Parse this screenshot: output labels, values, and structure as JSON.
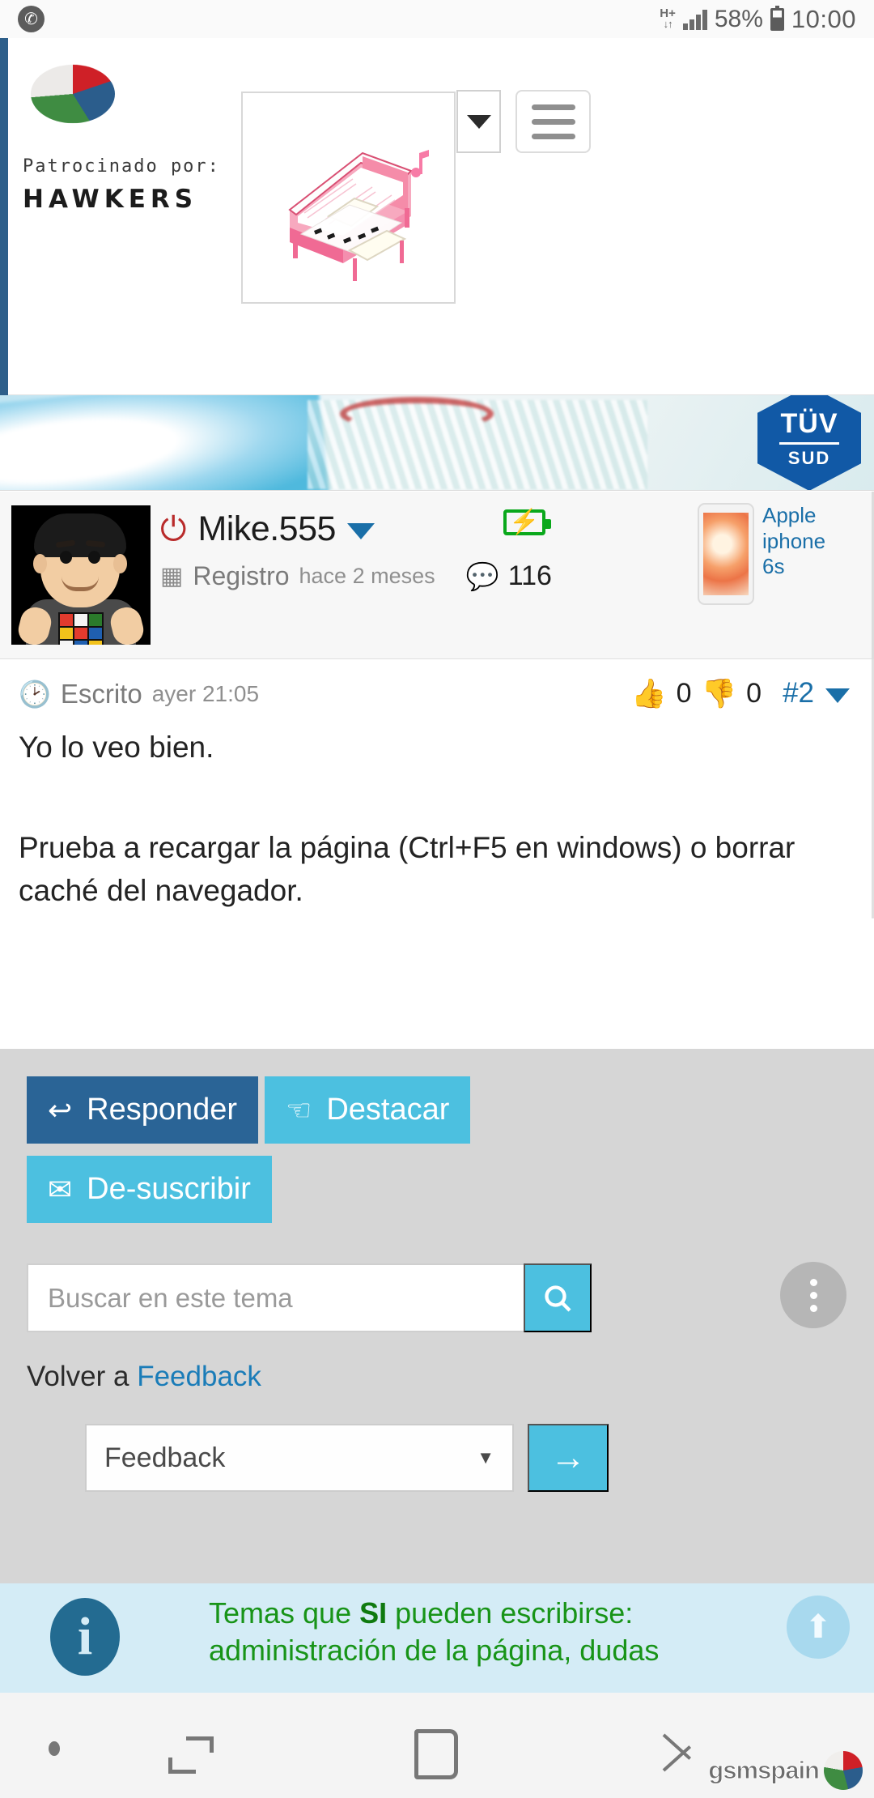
{
  "status_bar": {
    "phone_icon": "phone-icon",
    "network_type": "H+",
    "network_arrows": "↓↑",
    "battery_percent": "58%",
    "time": "10:00"
  },
  "sponsor": {
    "logo_icon": "gsmspain-pie-logo",
    "label": "Patrocinado por:",
    "brand": "HAWKERS",
    "ad_image_alt": "pink-pixel-piano",
    "caret_icon": "▼",
    "menu_icon": "hamburger-icon"
  },
  "banner_ad": {
    "badge_top": "TÜV",
    "badge_bottom": "SUD"
  },
  "post_header": {
    "avatar_alt": "cartoon-avatar-rubiks-cube",
    "status_icon": "power-icon",
    "username": "Mike.555",
    "user_caret": "▼",
    "charging_icon": "battery-charging-icon",
    "charging_bolt": "⚡",
    "register_icon": "calendar-icon",
    "register_label": "Registro",
    "register_value": "hace 2 meses",
    "comment_icon": "comment-bubble-icon",
    "comment_count": "116",
    "promo_image_alt": "apple-iphone-6s-thumbnail",
    "promo_text": "Apple iphone 6s"
  },
  "post": {
    "clock_icon": "clock-icon",
    "written_label": "Escrito",
    "written_time": "ayer 21:05",
    "thumb_up_icon": "👍",
    "thumb_up_count": "0",
    "thumb_down_icon": "👎",
    "thumb_down_count": "0",
    "post_number": "#2",
    "post_number_caret": "▼",
    "paragraphs": [
      "Yo lo veo bien.",
      "Prueba a recargar la página (Ctrl+F5 en windows) o borrar caché del navegador."
    ]
  },
  "actions": {
    "reply_icon": "↩",
    "reply_label": "Responder",
    "highlight_icon": "☝",
    "highlight_label": "Destacar",
    "unsubscribe_icon": "✉",
    "unsubscribe_label": "De-suscribir",
    "search_placeholder": "Buscar en este tema",
    "search_icon": "search-icon",
    "back_to_prefix": "Volver a",
    "back_to_link": "Feedback",
    "forum_selected": "Feedback",
    "forum_caret": "▼",
    "go_icon": "→",
    "more_icon": "kebab-menu-icon"
  },
  "info_box": {
    "icon": "i",
    "text_start": "Temas que ",
    "text_bold": "SI",
    "text_end": " pueden escribirse:",
    "text_line2": "administración de la página, dudas",
    "scroll_top_icon": "⬆"
  },
  "nav_bar": {
    "dot_icon": "dot-icon",
    "recents_icon": "recents-icon",
    "home_icon": "home-icon",
    "back_icon": "back-arrow-icon",
    "watermark_text": "gsmspain",
    "watermark_logo": "gsmspain-pie-logo"
  },
  "colors": {
    "primary_blue": "#2a6496",
    "info_blue": "#4cc0e0",
    "link_blue": "#1a7cb8",
    "green": "#189418",
    "red": "#e02020",
    "panel_gray": "#d6d6d6"
  }
}
